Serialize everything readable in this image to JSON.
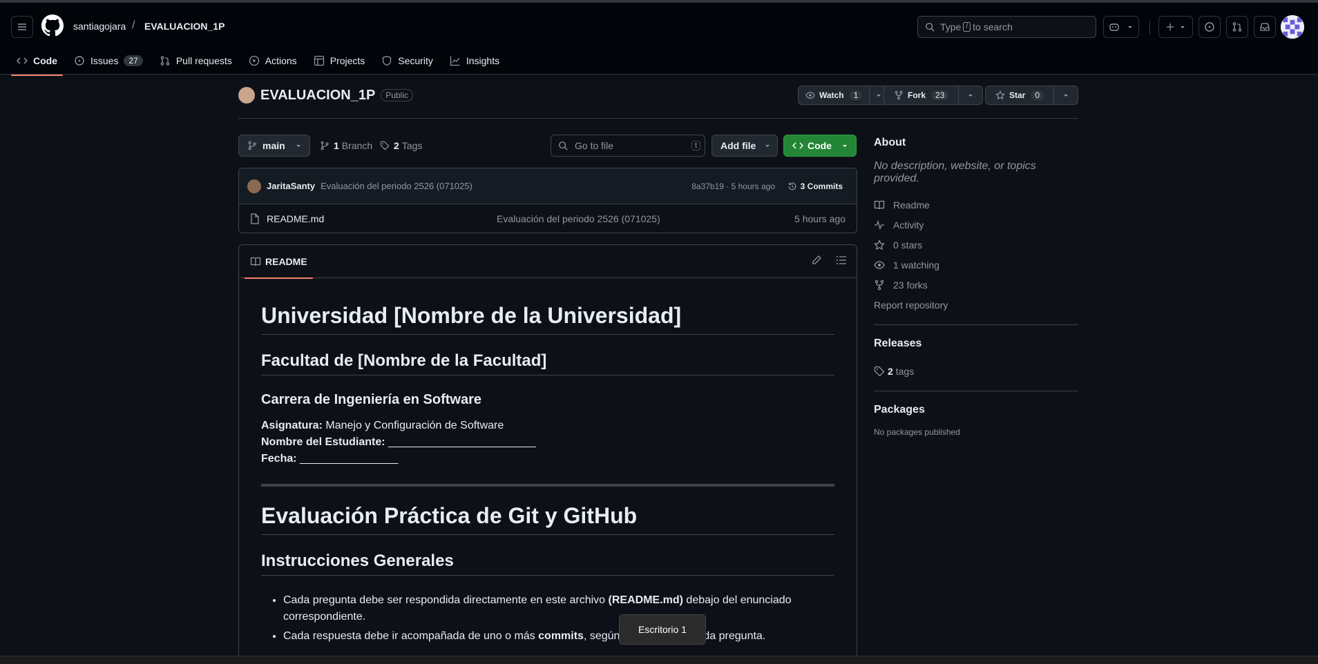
{
  "header": {
    "owner": "santiagojara",
    "separator": "/",
    "repo": "EVALUACION_1P",
    "search_prefix": "Type",
    "search_key": "/",
    "search_suffix": "to search"
  },
  "tabs": [
    {
      "label": "Code",
      "active": true
    },
    {
      "label": "Issues",
      "count": "27"
    },
    {
      "label": "Pull requests"
    },
    {
      "label": "Actions"
    },
    {
      "label": "Projects"
    },
    {
      "label": "Security"
    },
    {
      "label": "Insights"
    }
  ],
  "repo": {
    "name": "EVALUACION_1P",
    "visibility": "Public",
    "watch_label": "Watch",
    "watch_count": "1",
    "fork_label": "Fork",
    "fork_count": "23",
    "star_label": "Star",
    "star_count": "0"
  },
  "branchbar": {
    "branch": "main",
    "branch_count": "1",
    "branch_label": "Branch",
    "tag_count": "2",
    "tag_label": "Tags",
    "goto_placeholder": "Go to file",
    "goto_key": "t",
    "add_file": "Add file",
    "code": "Code"
  },
  "commit": {
    "user": "JaritaSanty",
    "message": "Evaluación del periodo 2526 (071025)",
    "hash_time": "8a37b19 · 5 hours ago",
    "commits": "3 Commits"
  },
  "files": [
    {
      "name": "README.md",
      "message": "Evaluación del periodo 2526 (071025)",
      "time": "5 hours ago"
    }
  ],
  "readme": {
    "tab": "README",
    "h1": "Universidad [Nombre de la Universidad]",
    "h2": "Facultad de [Nombre de la Facultad]",
    "h3": "Carrera de Ingeniería en Software",
    "asignatura_label": "Asignatura:",
    "asignatura_value": "Manejo y Configuración de Software",
    "estudiante_label": "Nombre del Estudiante:",
    "estudiante_value": "________________________",
    "fecha_label": "Fecha:",
    "fecha_value": "________________",
    "h1b": "Evaluación Práctica de Git y GitHub",
    "h2b": "Instrucciones Generales",
    "bullet1_pre": "Cada pregunta debe ser respondida directamente en este archivo ",
    "bullet1_bold": "(README.md)",
    "bullet1_post": " debajo del enunciado correspondiente.",
    "bullet2_pre": "Cada respuesta debe ir acompañada de uno o más ",
    "bullet2_bold": "commits",
    "bullet2_post": ", según se indique en cada pregunta."
  },
  "sidebar": {
    "about": "About",
    "description": "No description, website, or topics provided.",
    "items": [
      "Readme",
      "Activity",
      "0 stars",
      "1 watching",
      "23 forks"
    ],
    "report": "Report repository",
    "releases": "Releases",
    "tags_count": "2",
    "tags_label": "tags",
    "packages": "Packages",
    "no_packages": "No packages published"
  },
  "toast": "Escritorio 1",
  "colors": {
    "accent": "#f78166",
    "green": "#238636",
    "bg": "#0d1117"
  }
}
